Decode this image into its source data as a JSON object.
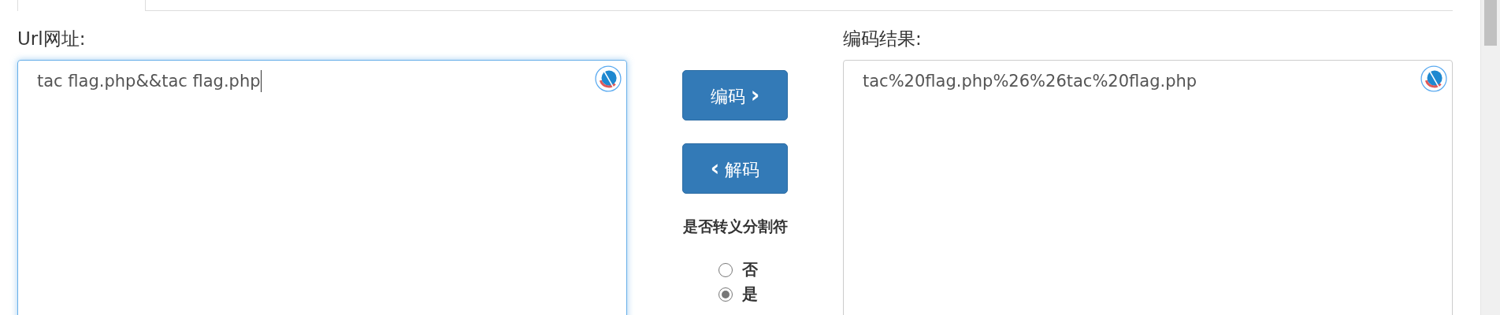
{
  "input_panel": {
    "label": "Url网址:",
    "value": "tac flag.php&&tac flag.php",
    "focused": true
  },
  "actions": {
    "encode_button": {
      "label": "编码",
      "icon": "›"
    },
    "decode_button": {
      "label": "解码",
      "icon": "‹"
    },
    "escape_label": "是否转义分割符",
    "options": [
      {
        "label": "否",
        "selected": false
      },
      {
        "label": "是",
        "selected": true
      }
    ]
  },
  "output_panel": {
    "label": "编码结果:",
    "value": "tac%20flag.php%26%26tac%20flag.php",
    "focused": false
  }
}
